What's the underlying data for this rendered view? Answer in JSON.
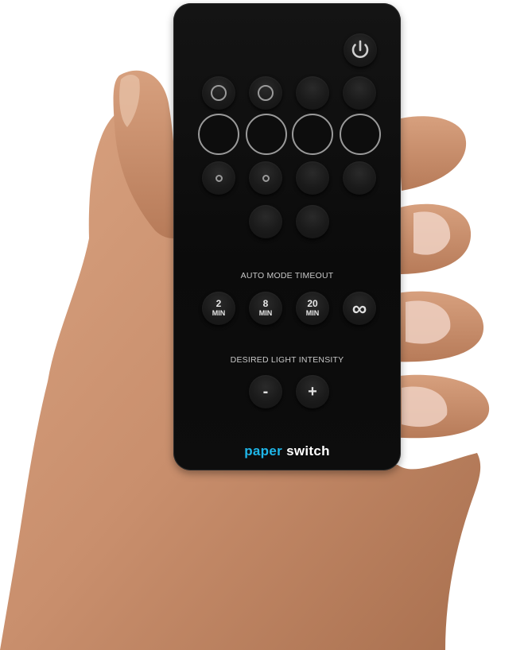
{
  "remote": {
    "auto_mode_label": "AUTO MODE TIMEOUT",
    "timeouts": [
      {
        "number": "2",
        "unit": "MIN"
      },
      {
        "number": "8",
        "unit": "MIN"
      },
      {
        "number": "20",
        "unit": "MIN"
      }
    ],
    "infinite_symbol": "∞",
    "intensity_label": "DESIRED LIGHT INTENSITY",
    "minus_label": "-",
    "plus_label": "+",
    "brand_part1": "paper",
    "brand_part2": "switch"
  },
  "colors": {
    "remote_body": "#0d0d0d",
    "brand_accent": "#1fb6e8",
    "ring": "#9a9a9a",
    "skin": "#c98f6d"
  },
  "icons": [
    "power-icon",
    "infinity-icon",
    "minus-icon",
    "plus-icon"
  ]
}
